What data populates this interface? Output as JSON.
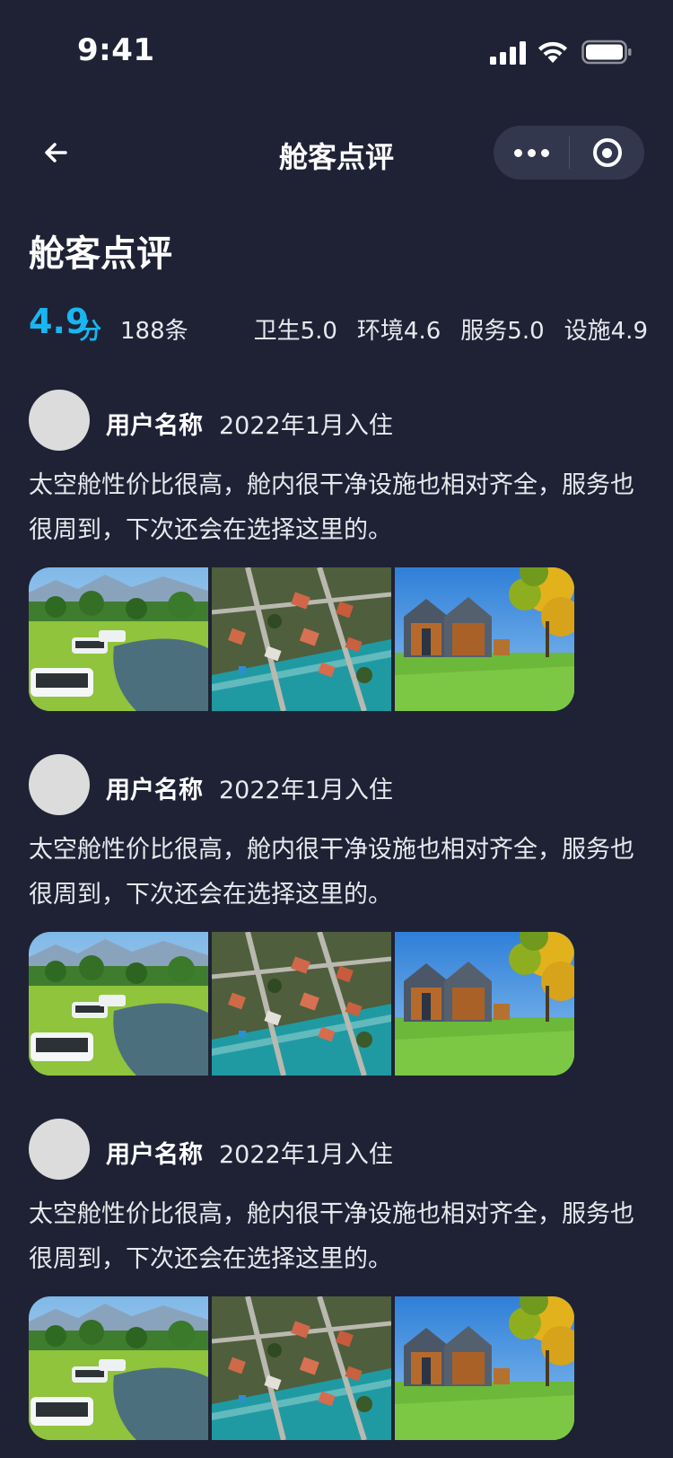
{
  "status_bar": {
    "time": "9:41"
  },
  "nav": {
    "title": "舱客点评"
  },
  "page": {
    "title": "舱客点评",
    "score": "4.9",
    "score_unit": "分",
    "review_count": "188条",
    "subscores": [
      {
        "label": "卫生5.0"
      },
      {
        "label": "环境4.6"
      },
      {
        "label": "服务5.0"
      },
      {
        "label": "设施4.9"
      }
    ]
  },
  "reviews": [
    {
      "username": "用户名称",
      "stay_date": "2022年1月入住",
      "text": "太空舱性价比很高，舱内很干净设施也相对齐全，服务也很周到，下次还会在选择这里的。",
      "photos": [
        "camp-lake-photo",
        "aerial-town-photo",
        "modern-house-photo"
      ]
    },
    {
      "username": "用户名称",
      "stay_date": "2022年1月入住",
      "text": "太空舱性价比很高，舱内很干净设施也相对齐全，服务也很周到，下次还会在选择这里的。",
      "photos": [
        "camp-lake-photo",
        "aerial-town-photo",
        "modern-house-photo"
      ]
    },
    {
      "username": "用户名称",
      "stay_date": "2022年1月入住",
      "text": "太空舱性价比很高，舱内很干净设施也相对齐全，服务也很周到，下次还会在选择这里的。",
      "photos": [
        "camp-lake-photo",
        "aerial-town-photo",
        "modern-house-photo"
      ]
    }
  ],
  "colors": {
    "background": "#1f2235",
    "accent": "#19b6f0",
    "capsule": "#33374d"
  }
}
